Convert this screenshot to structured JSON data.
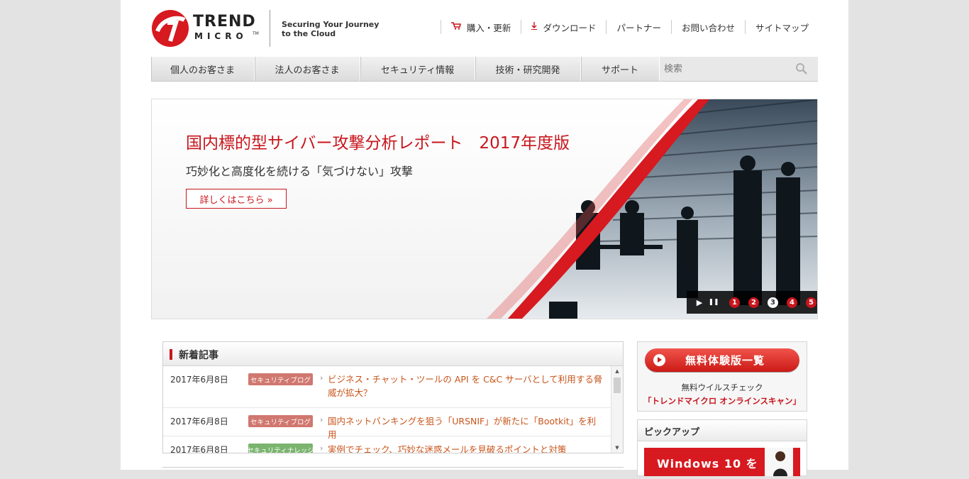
{
  "header": {
    "logo_word1": "TREND",
    "logo_word2": "MICRO",
    "logo_tm": "TM",
    "tagline_line1": "Securing Your Journey",
    "tagline_line2": "to the Cloud",
    "utility": [
      {
        "label": "購入・更新",
        "icon": "cart-icon"
      },
      {
        "label": "ダウンロード",
        "icon": "download-icon"
      },
      {
        "label": "パートナー"
      },
      {
        "label": "お問い合わせ"
      },
      {
        "label": "サイトマップ"
      }
    ]
  },
  "nav": {
    "items": [
      "個人のお客さま",
      "法人のお客さま",
      "セキュリティ情報",
      "技術・研究開発",
      "サポート"
    ],
    "search_placeholder": "検索"
  },
  "banner": {
    "title": "国内標的型サイバー攻撃分析レポート　2017年度版",
    "subtitle": "巧妙化と高度化を続ける「気づけない」攻撃",
    "button_label": "詳しくはこちら »",
    "controls": {
      "play": "▶",
      "pause": "❚❚",
      "slides": [
        "1",
        "2",
        "3",
        "4",
        "5"
      ],
      "active_slide": 3
    }
  },
  "news": {
    "title": "新着記事",
    "rows": [
      {
        "date": "2017年6月8日",
        "tag": "セキュリティブログ",
        "link": "ビジネス・チャット・ツールの API を C&C サーバとして利用する脅威が拡大？"
      },
      {
        "date": "2017年6月8日",
        "tag": "セキュリティブログ",
        "link": "国内ネットバンキングを狙う「URSNIF」が新たに「Bootkit」を利用"
      },
      {
        "date": "2017年6月8日",
        "tag": "セキュリティナレッジ",
        "link": "実例でチェック、巧妙な迷惑メールを見破るポイントと対策"
      }
    ],
    "scroll_up": "▲",
    "scroll_down": "▼"
  },
  "sidebar": {
    "trial_button": "無料体験版一覧",
    "trial_text1": "無料ウイルスチェック",
    "trial_text2": "「トレンドマイクロ オンラインスキャン」",
    "pickup_title": "ピックアップ",
    "pickup_banner": "Windows 10 を"
  },
  "colors": {
    "brand_red": "#c8161d",
    "link_orange": "#c8541a",
    "tag_red": "#d0776f",
    "tag_green": "#7ab46e"
  }
}
